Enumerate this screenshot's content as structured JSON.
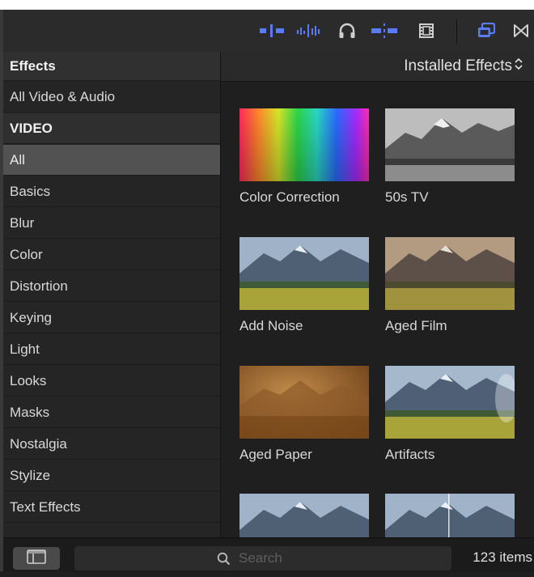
{
  "toolbar": {
    "icons": [
      "video-only-icon",
      "audio-only-icon",
      "headphones-icon",
      "snapping-icon",
      "viewer-icon",
      "browser-toggle-icon",
      "transitions-icon"
    ],
    "accent_color": "#5b7bff"
  },
  "sidebar": {
    "header": "Effects",
    "items": [
      {
        "label": "All Video & Audio",
        "kind": "item"
      },
      {
        "label": "VIDEO",
        "kind": "section"
      },
      {
        "label": "All",
        "kind": "selected"
      },
      {
        "label": "Basics",
        "kind": "item"
      },
      {
        "label": "Blur",
        "kind": "item"
      },
      {
        "label": "Color",
        "kind": "item"
      },
      {
        "label": "Distortion",
        "kind": "item"
      },
      {
        "label": "Keying",
        "kind": "item"
      },
      {
        "label": "Light",
        "kind": "item"
      },
      {
        "label": "Looks",
        "kind": "item"
      },
      {
        "label": "Masks",
        "kind": "item"
      },
      {
        "label": "Nostalgia",
        "kind": "item"
      },
      {
        "label": "Stylize",
        "kind": "item"
      },
      {
        "label": "Text Effects",
        "kind": "item"
      }
    ]
  },
  "main": {
    "filter_label": "Installed Effects",
    "tiles": [
      {
        "label": "Color Correction",
        "thumb": "spectrum"
      },
      {
        "label": "50s TV",
        "thumb": "bw"
      },
      {
        "label": "Add Noise",
        "thumb": "landscape"
      },
      {
        "label": "Aged Film",
        "thumb": "aged-film"
      },
      {
        "label": "Aged Paper",
        "thumb": "aged-paper"
      },
      {
        "label": "Artifacts",
        "thumb": "landscape-artifacts"
      },
      {
        "label": "",
        "thumb": "landscape"
      },
      {
        "label": "",
        "thumb": "landscape-split"
      }
    ]
  },
  "bottom": {
    "search_placeholder": "Search",
    "item_count": "123 items"
  }
}
